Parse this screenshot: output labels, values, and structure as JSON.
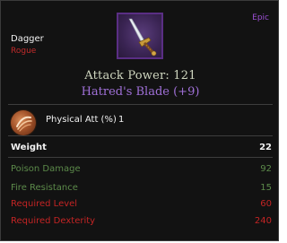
{
  "item": {
    "type": "Dagger",
    "class": "Rogue",
    "rarity": "Epic",
    "icon": "dagger-icon",
    "attack_power": "Attack Power: 121",
    "name": "Hatred's Blade (+9)"
  },
  "stat": {
    "icon": "slash-orb-icon",
    "label": "Physical Att (%)",
    "value": "1"
  },
  "weight": {
    "label": "Weight",
    "value": "22"
  },
  "bonuses": [
    {
      "label": "Poison Damage",
      "value": "92"
    },
    {
      "label": "Fire Resistance",
      "value": "15"
    }
  ],
  "requirements": [
    {
      "label": "Required Level",
      "value": "60"
    },
    {
      "label": "Required Dexterity",
      "value": "240"
    }
  ],
  "colors": {
    "rarity_epic": "#9b4fd3",
    "bonus_green": "#5c8a4a",
    "requirement_red": "#c42424"
  }
}
